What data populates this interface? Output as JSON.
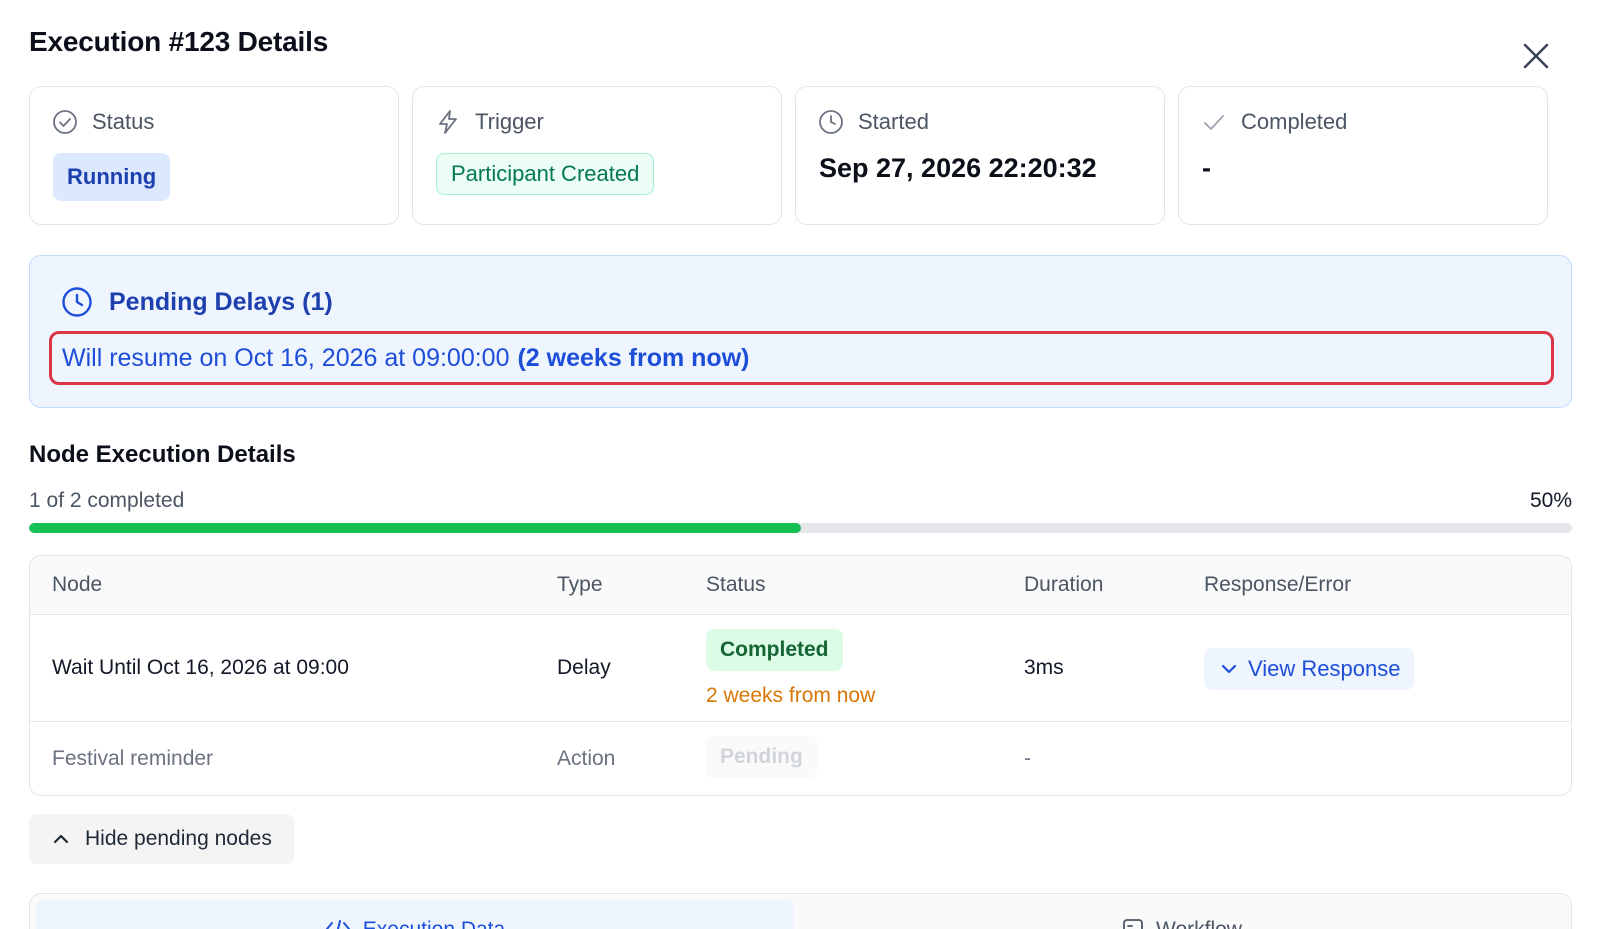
{
  "dialog": {
    "title": "Execution #123 Details",
    "close_icon": "close-icon"
  },
  "summary_cards": {
    "status": {
      "label": "Status",
      "icon": "check-circle-icon",
      "value": "Running"
    },
    "trigger": {
      "label": "Trigger",
      "icon": "lightning-icon",
      "value": "Participant Created"
    },
    "started": {
      "label": "Started",
      "icon": "clock-icon",
      "value": "Sep 27, 2026 22:20:32"
    },
    "completed": {
      "label": "Completed",
      "icon": "checkmark-icon",
      "value": "-"
    }
  },
  "pending_delays": {
    "title": "Pending Delays (1)",
    "icon": "clock-icon",
    "resume_text": "Will resume on Oct 16, 2026 at 09:00:00",
    "resume_relative": "(2 weeks from now)"
  },
  "node_execution": {
    "title": "Node Execution Details",
    "progress_label": "1 of 2 completed",
    "progress_percent_label": "50%",
    "progress_fraction": 0.5,
    "columns": [
      "Node",
      "Type",
      "Status",
      "Duration",
      "Response/Error"
    ],
    "rows": [
      {
        "node": "Wait Until Oct 16, 2026 at 09:00",
        "type": "Delay",
        "status": "Completed",
        "status_note": "2 weeks from now",
        "duration": "3ms",
        "response_action": "View Response"
      },
      {
        "node": "Festival reminder",
        "type": "Action",
        "status": "Pending",
        "duration": "-",
        "response_action": ""
      }
    ],
    "toggle_label": "Hide pending nodes"
  },
  "tabs": [
    {
      "label": "Execution Data",
      "icon": "code-icon",
      "active": true
    },
    {
      "label": "Workflow",
      "icon": "workflow-icon",
      "active": false
    }
  ],
  "colors": {
    "accent_blue": "#1d4ed8",
    "success_green": "#16c154",
    "warning_orange": "#d97706",
    "highlight_red": "#dc3545"
  }
}
